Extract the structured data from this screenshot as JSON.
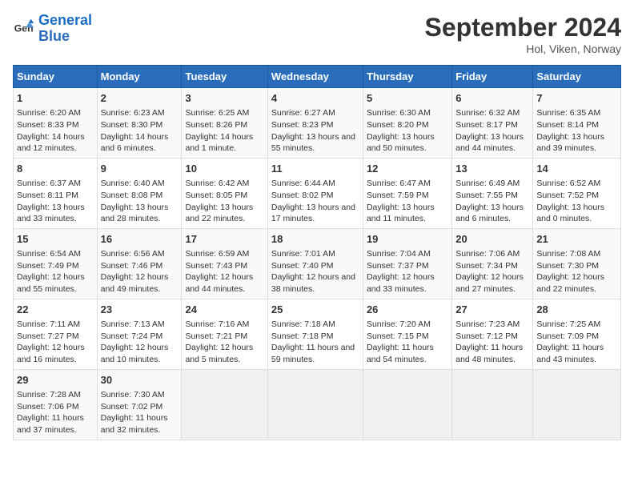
{
  "header": {
    "logo_line1": "General",
    "logo_line2": "Blue",
    "title": "September 2024",
    "subtitle": "Hol, Viken, Norway"
  },
  "weekdays": [
    "Sunday",
    "Monday",
    "Tuesday",
    "Wednesday",
    "Thursday",
    "Friday",
    "Saturday"
  ],
  "weeks": [
    [
      {
        "day": "1",
        "info": "Sunrise: 6:20 AM\nSunset: 8:33 PM\nDaylight: 14 hours and 12 minutes."
      },
      {
        "day": "2",
        "info": "Sunrise: 6:23 AM\nSunset: 8:30 PM\nDaylight: 14 hours and 6 minutes."
      },
      {
        "day": "3",
        "info": "Sunrise: 6:25 AM\nSunset: 8:26 PM\nDaylight: 14 hours and 1 minute."
      },
      {
        "day": "4",
        "info": "Sunrise: 6:27 AM\nSunset: 8:23 PM\nDaylight: 13 hours and 55 minutes."
      },
      {
        "day": "5",
        "info": "Sunrise: 6:30 AM\nSunset: 8:20 PM\nDaylight: 13 hours and 50 minutes."
      },
      {
        "day": "6",
        "info": "Sunrise: 6:32 AM\nSunset: 8:17 PM\nDaylight: 13 hours and 44 minutes."
      },
      {
        "day": "7",
        "info": "Sunrise: 6:35 AM\nSunset: 8:14 PM\nDaylight: 13 hours and 39 minutes."
      }
    ],
    [
      {
        "day": "8",
        "info": "Sunrise: 6:37 AM\nSunset: 8:11 PM\nDaylight: 13 hours and 33 minutes."
      },
      {
        "day": "9",
        "info": "Sunrise: 6:40 AM\nSunset: 8:08 PM\nDaylight: 13 hours and 28 minutes."
      },
      {
        "day": "10",
        "info": "Sunrise: 6:42 AM\nSunset: 8:05 PM\nDaylight: 13 hours and 22 minutes."
      },
      {
        "day": "11",
        "info": "Sunrise: 6:44 AM\nSunset: 8:02 PM\nDaylight: 13 hours and 17 minutes."
      },
      {
        "day": "12",
        "info": "Sunrise: 6:47 AM\nSunset: 7:59 PM\nDaylight: 13 hours and 11 minutes."
      },
      {
        "day": "13",
        "info": "Sunrise: 6:49 AM\nSunset: 7:55 PM\nDaylight: 13 hours and 6 minutes."
      },
      {
        "day": "14",
        "info": "Sunrise: 6:52 AM\nSunset: 7:52 PM\nDaylight: 13 hours and 0 minutes."
      }
    ],
    [
      {
        "day": "15",
        "info": "Sunrise: 6:54 AM\nSunset: 7:49 PM\nDaylight: 12 hours and 55 minutes."
      },
      {
        "day": "16",
        "info": "Sunrise: 6:56 AM\nSunset: 7:46 PM\nDaylight: 12 hours and 49 minutes."
      },
      {
        "day": "17",
        "info": "Sunrise: 6:59 AM\nSunset: 7:43 PM\nDaylight: 12 hours and 44 minutes."
      },
      {
        "day": "18",
        "info": "Sunrise: 7:01 AM\nSunset: 7:40 PM\nDaylight: 12 hours and 38 minutes."
      },
      {
        "day": "19",
        "info": "Sunrise: 7:04 AM\nSunset: 7:37 PM\nDaylight: 12 hours and 33 minutes."
      },
      {
        "day": "20",
        "info": "Sunrise: 7:06 AM\nSunset: 7:34 PM\nDaylight: 12 hours and 27 minutes."
      },
      {
        "day": "21",
        "info": "Sunrise: 7:08 AM\nSunset: 7:30 PM\nDaylight: 12 hours and 22 minutes."
      }
    ],
    [
      {
        "day": "22",
        "info": "Sunrise: 7:11 AM\nSunset: 7:27 PM\nDaylight: 12 hours and 16 minutes."
      },
      {
        "day": "23",
        "info": "Sunrise: 7:13 AM\nSunset: 7:24 PM\nDaylight: 12 hours and 10 minutes."
      },
      {
        "day": "24",
        "info": "Sunrise: 7:16 AM\nSunset: 7:21 PM\nDaylight: 12 hours and 5 minutes."
      },
      {
        "day": "25",
        "info": "Sunrise: 7:18 AM\nSunset: 7:18 PM\nDaylight: 11 hours and 59 minutes."
      },
      {
        "day": "26",
        "info": "Sunrise: 7:20 AM\nSunset: 7:15 PM\nDaylight: 11 hours and 54 minutes."
      },
      {
        "day": "27",
        "info": "Sunrise: 7:23 AM\nSunset: 7:12 PM\nDaylight: 11 hours and 48 minutes."
      },
      {
        "day": "28",
        "info": "Sunrise: 7:25 AM\nSunset: 7:09 PM\nDaylight: 11 hours and 43 minutes."
      }
    ],
    [
      {
        "day": "29",
        "info": "Sunrise: 7:28 AM\nSunset: 7:06 PM\nDaylight: 11 hours and 37 minutes."
      },
      {
        "day": "30",
        "info": "Sunrise: 7:30 AM\nSunset: 7:02 PM\nDaylight: 11 hours and 32 minutes."
      },
      {
        "day": "",
        "info": ""
      },
      {
        "day": "",
        "info": ""
      },
      {
        "day": "",
        "info": ""
      },
      {
        "day": "",
        "info": ""
      },
      {
        "day": "",
        "info": ""
      }
    ]
  ]
}
